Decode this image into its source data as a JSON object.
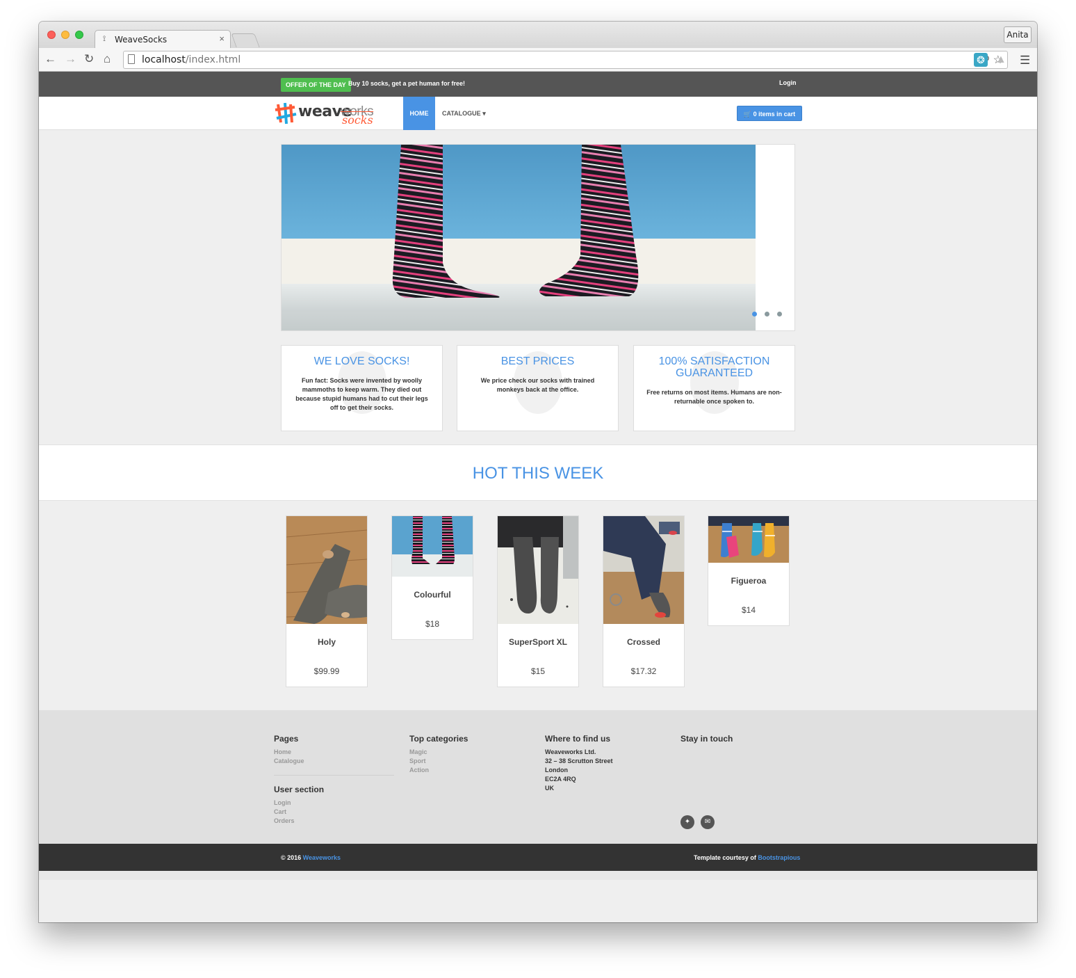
{
  "browser": {
    "tab_title": "WeaveSocks",
    "url_host": "localhost",
    "url_path": "/index.html",
    "profile_name": "Anita"
  },
  "topbar": {
    "offer_badge": "OFFER OF THE DAY",
    "offer_text": "Buy 10 socks, get a pet human for free!",
    "login": "Login"
  },
  "nav": {
    "logo_weave": "weave",
    "logo_works": "works",
    "logo_socks": "socks",
    "home": "HOME",
    "catalogue": "CATALOGUE",
    "cart": "0 items in cart"
  },
  "hero": {
    "slides": 3,
    "active_slide": 1
  },
  "features": [
    {
      "title": "WE LOVE SOCKS!",
      "text": "Fun fact: Socks were invented by woolly mammoths to keep warm. They died out because stupid humans had to cut their legs off to get their socks."
    },
    {
      "title": "BEST PRICES",
      "text": "We price check our socks with trained monkeys back at the office."
    },
    {
      "title": "100% SATISFACTION GUARANTEED",
      "text": "Free returns on most items. Humans are non-returnable once spoken to."
    }
  ],
  "hot": {
    "title": "HOT THIS WEEK"
  },
  "products": [
    {
      "name": "Holy",
      "price": "$99.99"
    },
    {
      "name": "Colourful",
      "price": "$18"
    },
    {
      "name": "SuperSport XL",
      "price": "$15"
    },
    {
      "name": "Crossed",
      "price": "$17.32"
    },
    {
      "name": "Figueroa",
      "price": "$14"
    }
  ],
  "footer": {
    "pages": {
      "title": "Pages",
      "links": [
        "Home",
        "Catalogue"
      ]
    },
    "user": {
      "title": "User section",
      "links": [
        "Login",
        "Cart",
        "Orders"
      ]
    },
    "categories": {
      "title": "Top categories",
      "links": [
        "Magic",
        "Sport",
        "Action"
      ]
    },
    "where": {
      "title": "Where to find us",
      "lines": [
        "Weaveworks Ltd.",
        "32 – 38 Scrutton Street",
        "London",
        "EC2A 4RQ",
        "UK"
      ]
    },
    "touch": {
      "title": "Stay in touch",
      "icons": [
        "twitter-icon",
        "envelope-icon"
      ]
    }
  },
  "copyright": {
    "left_prefix": "© 2016 ",
    "left_link": "Weaveworks",
    "right_prefix": "Template courtesy of ",
    "right_link": "Bootstrapious"
  },
  "colors": {
    "accent": "#4993e4",
    "offer": "#4fbe4f",
    "topbar": "#555555",
    "footer_bg": "#e0e0e0",
    "copy_bg": "#333333"
  }
}
